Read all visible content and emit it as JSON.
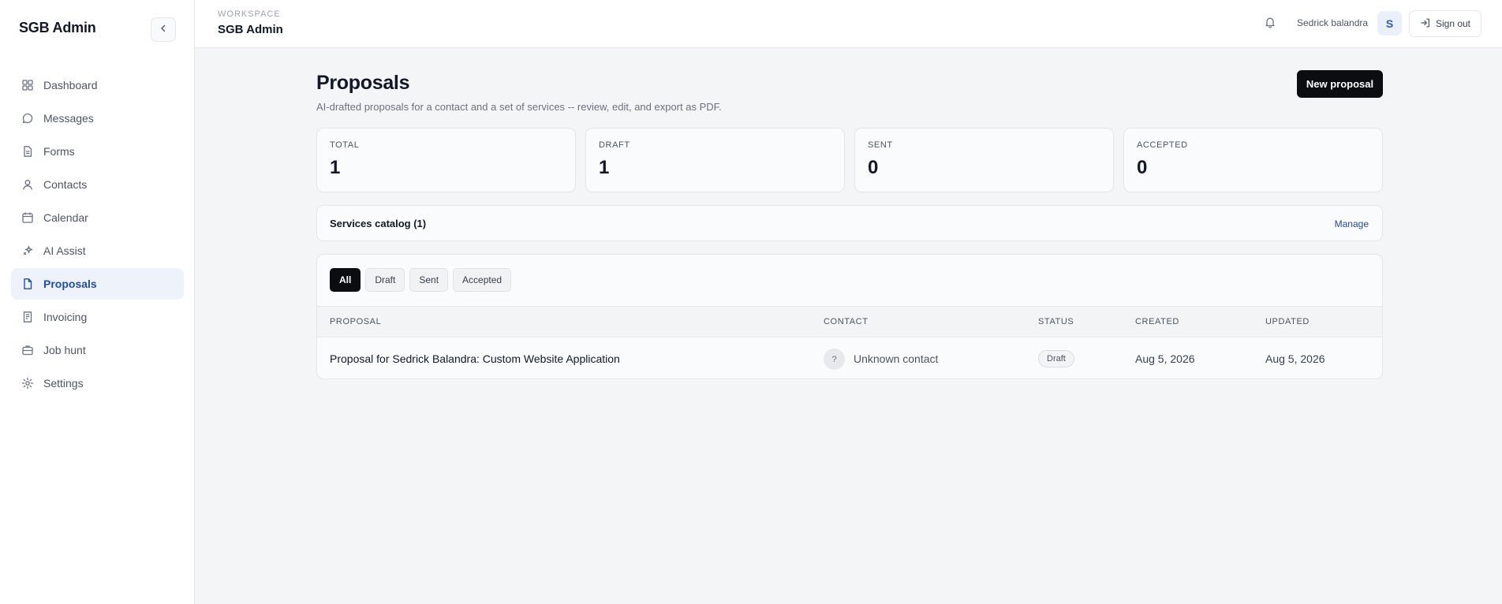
{
  "sidebar": {
    "brand": "SGB Admin",
    "collapse_icon": "chevron-left-icon",
    "items": [
      {
        "label": "Dashboard",
        "icon": "grid-icon"
      },
      {
        "label": "Messages",
        "icon": "chat-bubble-icon"
      },
      {
        "label": "Forms",
        "icon": "document-icon"
      },
      {
        "label": "Contacts",
        "icon": "user-icon"
      },
      {
        "label": "Calendar",
        "icon": "calendar-icon"
      },
      {
        "label": "AI Assist",
        "icon": "sparkle-icon"
      },
      {
        "label": "Proposals",
        "icon": "file-icon",
        "active": true
      },
      {
        "label": "Invoicing",
        "icon": "receipt-icon"
      },
      {
        "label": "Job hunt",
        "icon": "briefcase-icon"
      },
      {
        "label": "Settings",
        "icon": "gear-icon"
      }
    ]
  },
  "header": {
    "workspace_label": "WORKSPACE",
    "workspace_name": "SGB Admin",
    "user_name": "Sedrick balandra",
    "avatar_initial": "S",
    "sign_out_label": "Sign out"
  },
  "main": {
    "title": "Proposals",
    "subtitle": "AI-drafted proposals for a contact and a set of services -- review, edit, and export as PDF.",
    "new_button_label": "New proposal",
    "stats": [
      {
        "label": "TOTAL",
        "value": "1"
      },
      {
        "label": "DRAFT",
        "value": "1"
      },
      {
        "label": "SENT",
        "value": "0"
      },
      {
        "label": "ACCEPTED",
        "value": "0"
      }
    ],
    "catalog": {
      "title": "Services catalog (1)",
      "manage_label": "Manage"
    },
    "filters": [
      "All",
      "Draft",
      "Sent",
      "Accepted"
    ],
    "active_filter": "All",
    "table": {
      "columns": [
        "PROPOSAL",
        "CONTACT",
        "STATUS",
        "CREATED",
        "UPDATED"
      ],
      "rows": [
        {
          "proposal": "Proposal for Sedrick Balandra: Custom Website Application",
          "contact_initial": "?",
          "contact": "Unknown contact",
          "status": "Draft",
          "created": "Aug 5, 2026",
          "updated": "Aug 5, 2026"
        }
      ]
    }
  },
  "colors": {
    "accent": "#1e4fa8",
    "primary_button": "#0b0d10",
    "active_nav_bg": "#eef2fb",
    "page_bg": "#f4f5f7"
  }
}
